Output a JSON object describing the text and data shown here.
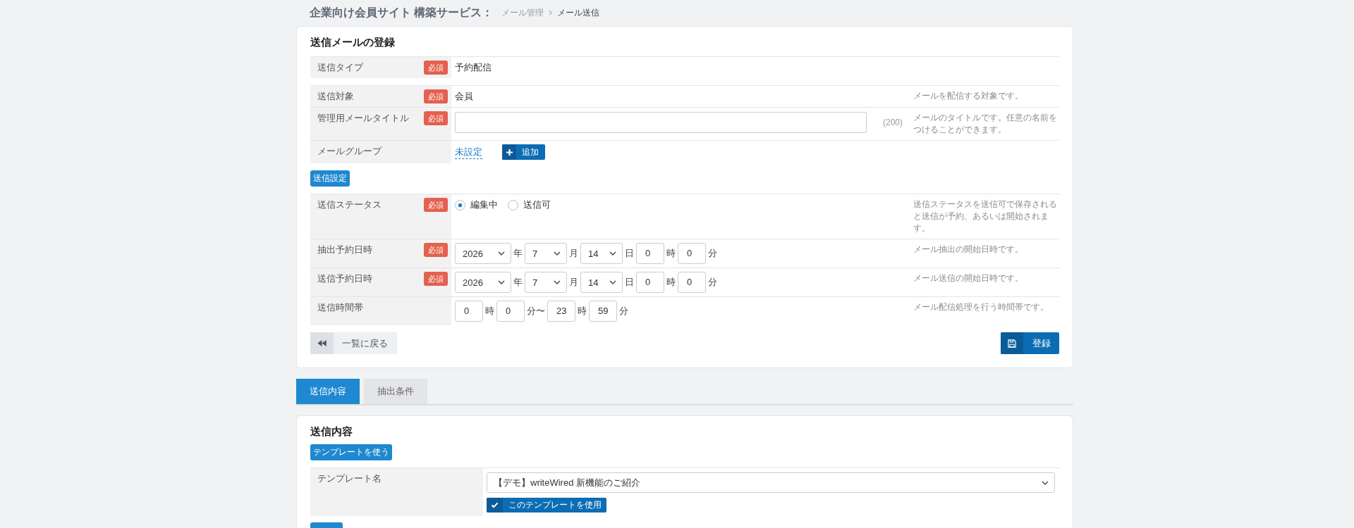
{
  "breadcrumb": {
    "site": "企業向け会員サイト 構築サービス：",
    "items": [
      {
        "label": "メール管理",
        "current": false
      },
      {
        "label": "メール送信",
        "current": true
      }
    ]
  },
  "register_card": {
    "title": "送信メールの登録",
    "blocks": [
      {
        "rows": [
          {
            "kind": "text",
            "label": "送信タイプ",
            "badge": "必須",
            "value": "予約配信"
          }
        ]
      },
      {
        "rows": [
          {
            "kind": "text",
            "label": "送信対象",
            "badge": "必須",
            "value": "会員",
            "description": "メールを配信する対象です。"
          },
          {
            "kind": "input",
            "label": "管理用メールタイトル",
            "badge": "必須",
            "counter": "(200)",
            "description": "メールのタイトルです。任意の名前をつけることができます。"
          },
          {
            "kind": "link",
            "label": "メールグループ",
            "link": "未設定",
            "button": "追加"
          }
        ]
      },
      {
        "heading_button": "送信設定",
        "rows": [
          {
            "kind": "radio",
            "label": "送信ステータス",
            "badge": "必須",
            "options": [
              {
                "label": "編集中",
                "selected": true
              },
              {
                "label": "送信可",
                "selected": false
              }
            ],
            "description": "送信ステータスを送信可で保存されると送信が予約、あるいは開始されます。"
          },
          {
            "kind": "parts",
            "label": "抽出予約日時",
            "badge": "必須",
            "parts": [
              {
                "kind": "select",
                "value": "2026",
                "unit": "年"
              },
              {
                "kind": "select",
                "value": "7",
                "unit": "月"
              },
              {
                "kind": "select",
                "value": "14",
                "unit": "日"
              },
              {
                "kind": "input",
                "value": "0",
                "unit": "時"
              },
              {
                "kind": "input",
                "value": "0",
                "unit": "分"
              }
            ],
            "description": "メール抽出の開始日時です。"
          },
          {
            "kind": "parts",
            "label": "送信予約日時",
            "badge": "必須",
            "parts": [
              {
                "kind": "select",
                "value": "2026",
                "unit": "年"
              },
              {
                "kind": "select",
                "value": "7",
                "unit": "月"
              },
              {
                "kind": "select",
                "value": "14",
                "unit": "日"
              },
              {
                "kind": "input",
                "value": "0",
                "unit": "時"
              },
              {
                "kind": "input",
                "value": "0",
                "unit": "分"
              }
            ],
            "description": "メール送信の開始日時です。"
          },
          {
            "kind": "parts",
            "label": "送信時間帯",
            "parts": [
              {
                "kind": "input",
                "value": "0",
                "unit": "時"
              },
              {
                "kind": "input",
                "value": "0",
                "unit": "分〜"
              },
              {
                "kind": "input",
                "value": "23",
                "unit": "時"
              },
              {
                "kind": "input",
                "value": "59",
                "unit": "分"
              }
            ],
            "description": "メール配信処理を行う時間帯です。"
          }
        ]
      }
    ],
    "back_button": "一覧に戻る",
    "submit_button": "登録"
  },
  "tabs": [
    {
      "label": "送信内容",
      "selected": true
    },
    {
      "label": "抽出条件",
      "selected": false
    }
  ],
  "content_card": {
    "title": "送信内容",
    "template_button": "テンプレートを使う",
    "rows": [
      {
        "label": "テンプレート名",
        "value": "【デモ】writeWired 新機能のご紹介",
        "button": "このテンプレートを使用"
      }
    ]
  }
}
